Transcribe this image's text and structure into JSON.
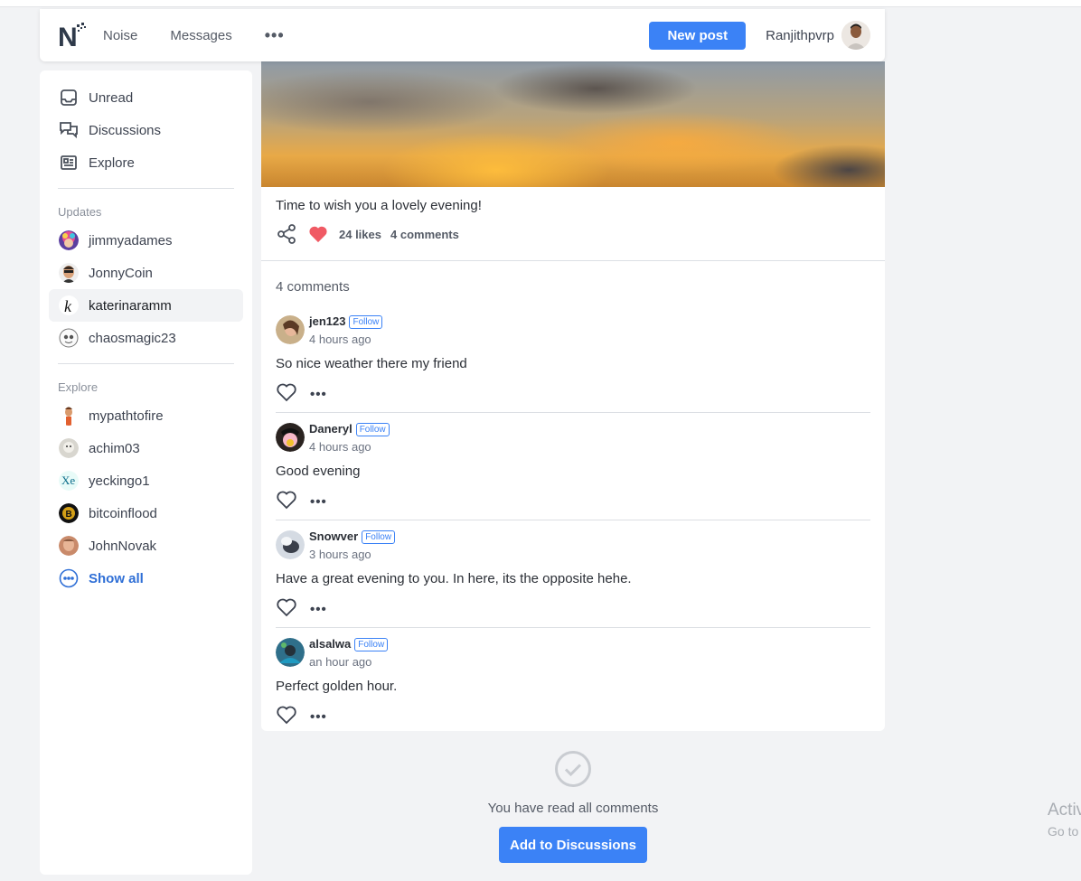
{
  "header": {
    "logo": "N",
    "nav": [
      "Noise",
      "Messages"
    ],
    "more": "•••",
    "new_post": "New post",
    "user": "Ranjithpvrp"
  },
  "sidebar": {
    "main_items": [
      {
        "label": "Unread",
        "icon": "inbox-icon"
      },
      {
        "label": "Discussions",
        "icon": "chat-bubbles-icon"
      },
      {
        "label": "Explore",
        "icon": "newspaper-icon"
      }
    ],
    "updates_heading": "Updates",
    "updates": [
      "jimmyadames",
      "JonnyCoin",
      "katerinaramm",
      "chaosmagic23"
    ],
    "explore_heading": "Explore",
    "explore": [
      "mypathtofire",
      "achim03",
      "yeckingo1",
      "bitcoinflood",
      "JohnNovak"
    ],
    "show_all": "Show all"
  },
  "post": {
    "caption": "Time to wish you a lovely evening!",
    "likes": "24 likes",
    "comments_count": "4 comments",
    "comments_title": "4 comments"
  },
  "comments": [
    {
      "author": "jen123",
      "follow": "Follow",
      "time": "4 hours ago",
      "text": "So nice weather there my friend",
      "more": "•••"
    },
    {
      "author": "Daneryl",
      "follow": "Follow",
      "time": "4 hours ago",
      "text": "Good evening",
      "more": "•••"
    },
    {
      "author": "Snowver",
      "follow": "Follow",
      "time": "3 hours ago",
      "text": "Have a great evening to you. In here, its the opposite hehe.",
      "more": "•••"
    },
    {
      "author": "alsalwa",
      "follow": "Follow",
      "time": "an hour ago",
      "text": "Perfect golden hour.",
      "more": "•••"
    }
  ],
  "footer": {
    "read_all": "You have read all comments",
    "add_button": "Add to Discussions"
  },
  "watermark": {
    "line1": "Activate Windows",
    "line2": "Go to Settings to activate Windows."
  },
  "colors": {
    "accent": "#3b82f6",
    "heart": "#f05a64",
    "link": "#2f6fd6"
  }
}
